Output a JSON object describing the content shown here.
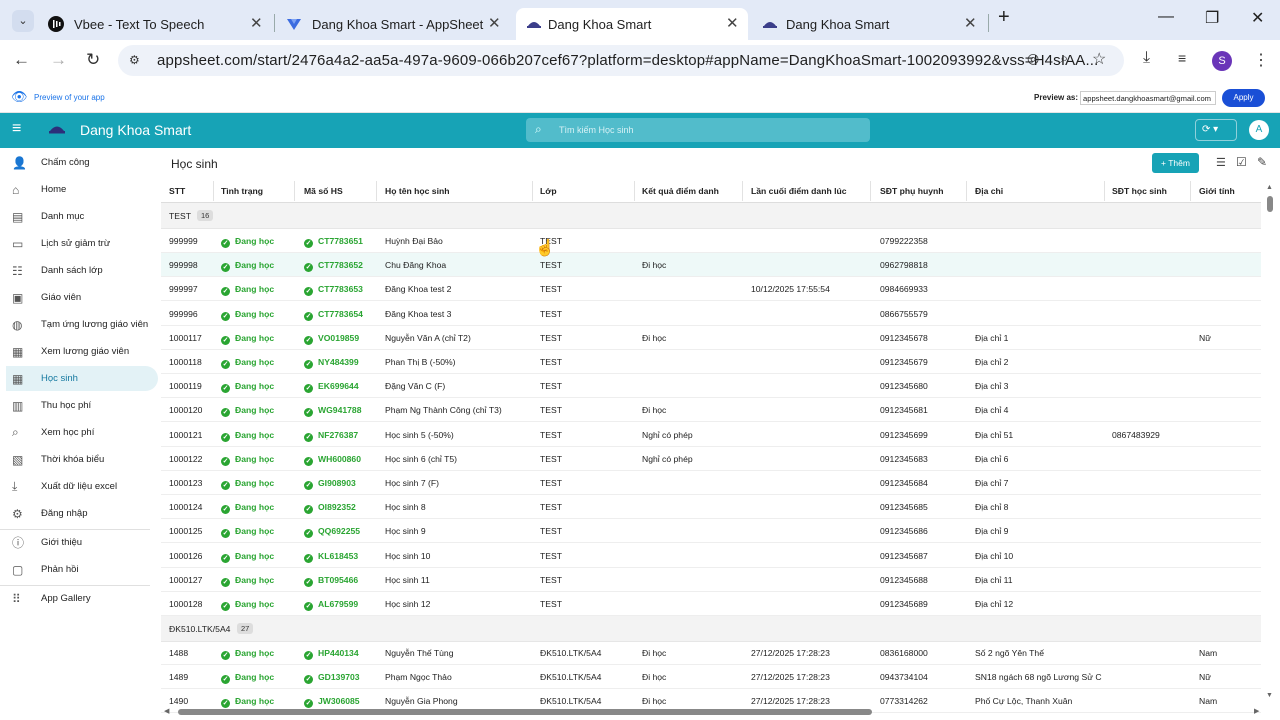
{
  "browser": {
    "tabs": [
      {
        "title": "Vbee - Text To Speech",
        "icon": "vbee-icon"
      },
      {
        "title": "Dang Khoa Smart - AppSheet",
        "icon": "appsheet-icon"
      },
      {
        "title": "Dang Khoa Smart",
        "icon": "app-icon",
        "active": true
      },
      {
        "title": "Dang Khoa Smart",
        "icon": "app-icon"
      }
    ],
    "url": "appsheet.com/start/2476a4a2-aa5a-497a-9609-066b207cef67?platform=desktop#appName=DangKhoaSmart-1002093992&vss=H4sIAA...",
    "profile_initial": "S"
  },
  "preview": {
    "label": "Preview of your app",
    "as_label": "Preview as:",
    "email": "appsheet.dangkhoasmart@gmail.com",
    "apply": "Apply"
  },
  "app": {
    "title": "Dang Khoa Smart",
    "search_placeholder": "Tìm kiếm Học sinh",
    "avatar": "A",
    "brand_color": "#17a3b6"
  },
  "sidebar": {
    "items": [
      {
        "label": "Chấm công",
        "icon": "attendance-icon"
      },
      {
        "label": "Home",
        "icon": "home-icon"
      },
      {
        "label": "Danh mục",
        "icon": "catalog-icon"
      },
      {
        "label": "Lịch sử giảm trừ",
        "icon": "history-icon"
      },
      {
        "label": "Danh sách lớp",
        "icon": "class-list-icon"
      },
      {
        "label": "Giáo viên",
        "icon": "teacher-icon"
      },
      {
        "label": "Tạm ứng lương giáo viên",
        "icon": "salary-advance-icon"
      },
      {
        "label": "Xem lương giáo viên",
        "icon": "salary-view-icon"
      },
      {
        "label": "Học sinh",
        "icon": "student-icon",
        "selected": true
      },
      {
        "label": "Thu học phí",
        "icon": "tuition-icon"
      },
      {
        "label": "Xem học phí",
        "icon": "search-tuition-icon"
      },
      {
        "label": "Thời khóa biểu",
        "icon": "schedule-icon"
      },
      {
        "label": "Xuất dữ liệu excel",
        "icon": "export-icon"
      },
      {
        "label": "Đăng nhập",
        "icon": "login-icon"
      },
      {
        "label": "Giới thiệu",
        "icon": "info-icon"
      },
      {
        "label": "Phản hồi",
        "icon": "feedback-icon"
      },
      {
        "label": "App Gallery",
        "icon": "apps-grid-icon"
      }
    ]
  },
  "view": {
    "title": "Học sinh",
    "add_label": "Thêm"
  },
  "table": {
    "columns": [
      "STT",
      "Tình trạng",
      "Mã số HS",
      "Họ tên học sinh",
      "Lớp",
      "Kết quả điểm danh",
      "Lần cuối điểm danh lúc",
      "SĐT phụ huynh",
      "Địa chỉ",
      "SĐT học sinh",
      "Giới tính"
    ],
    "groups": [
      {
        "name": "TEST",
        "count": "16"
      },
      {
        "name": "ĐK510.LTK/5A4",
        "count": "27"
      }
    ],
    "rows": [
      [
        "999999",
        "Đang học",
        "CT7783651",
        "Huỳnh Đại Bảo",
        "TEST",
        "",
        "",
        "0799222358",
        "",
        "",
        ""
      ],
      [
        "999998",
        "Đang học",
        "CT7783652",
        "Chu Đăng Khoa",
        "TEST",
        "Đi học",
        "",
        "0962798818",
        "",
        "",
        ""
      ],
      [
        "999997",
        "Đang học",
        "CT7783653",
        "Đăng Khoa test 2",
        "TEST",
        "",
        "10/12/2025 17:55:54",
        "0984669933",
        "",
        "",
        ""
      ],
      [
        "999996",
        "Đang học",
        "CT7783654",
        "Đăng Khoa test 3",
        "TEST",
        "",
        "",
        "0866755579",
        "",
        "",
        ""
      ],
      [
        "1000117",
        "Đang học",
        "VO019859",
        "Nguyễn Văn A (chỉ T2)",
        "TEST",
        "Đi học",
        "",
        "0912345678",
        "Địa chỉ 1",
        "",
        "Nữ"
      ],
      [
        "1000118",
        "Đang học",
        "NY484399",
        "Phan Thị B (-50%)",
        "TEST",
        "",
        "",
        "0912345679",
        "Địa chỉ 2",
        "",
        ""
      ],
      [
        "1000119",
        "Đang học",
        "EK699644",
        "Đặng Văn C (F)",
        "TEST",
        "",
        "",
        "0912345680",
        "Địa chỉ 3",
        "",
        ""
      ],
      [
        "1000120",
        "Đang học",
        "WG941788",
        "Phạm Ng Thành Công (chỉ T3)",
        "TEST",
        "Đi học",
        "",
        "0912345681",
        "Địa chỉ 4",
        "",
        ""
      ],
      [
        "1000121",
        "Đang học",
        "NF276387",
        "Học sinh 5 (-50%)",
        "TEST",
        "Nghỉ có phép",
        "",
        "0912345699",
        "Địa chỉ 51",
        "0867483929",
        ""
      ],
      [
        "1000122",
        "Đang học",
        "WH600860",
        "Học sinh 6 (chỉ T5)",
        "TEST",
        "Nghỉ có phép",
        "",
        "0912345683",
        "Địa chỉ 6",
        "",
        ""
      ],
      [
        "1000123",
        "Đang học",
        "GI908903",
        "Học sinh 7 (F)",
        "TEST",
        "",
        "",
        "0912345684",
        "Địa chỉ 7",
        "",
        ""
      ],
      [
        "1000124",
        "Đang học",
        "OI892352",
        "Học sinh 8",
        "TEST",
        "",
        "",
        "0912345685",
        "Địa chỉ 8",
        "",
        ""
      ],
      [
        "1000125",
        "Đang học",
        "QQ692255",
        "Học sinh 9",
        "TEST",
        "",
        "",
        "0912345686",
        "Địa chỉ 9",
        "",
        ""
      ],
      [
        "1000126",
        "Đang học",
        "KL618453",
        "Học sinh 10",
        "TEST",
        "",
        "",
        "0912345687",
        "Địa chỉ 10",
        "",
        ""
      ],
      [
        "1000127",
        "Đang học",
        "BT095466",
        "Học sinh 11",
        "TEST",
        "",
        "",
        "0912345688",
        "Địa chỉ 11",
        "",
        ""
      ],
      [
        "1000128",
        "Đang học",
        "AL679599",
        "Học sinh 12",
        "TEST",
        "",
        "",
        "0912345689",
        "Địa chỉ 12",
        "",
        ""
      ],
      [
        "1488",
        "Đang học",
        "HP440134",
        "Nguyễn Thế Tùng",
        "ĐK510.LTK/5A4",
        "Đi học",
        "27/12/2025 17:28:23",
        "0836168000",
        "Số 2 ngõ Yên Thế",
        "",
        "Nam"
      ],
      [
        "1489",
        "Đang học",
        "GD139703",
        "Phạm Ngọc Thảo",
        "ĐK510.LTK/5A4",
        "Đi học",
        "27/12/2025 17:28:23",
        "0943734104",
        "SN18 ngách 68 ngõ Lương Sử C",
        "",
        "Nữ"
      ],
      [
        "1490",
        "Đang học",
        "JW306085",
        "Nguyễn Gia Phong",
        "ĐK510.LTK/5A4",
        "Đi học",
        "27/12/2025 17:28:23",
        "0773314262",
        "Phố Cự Lộc, Thanh Xuân",
        "",
        "Nam"
      ]
    ]
  }
}
